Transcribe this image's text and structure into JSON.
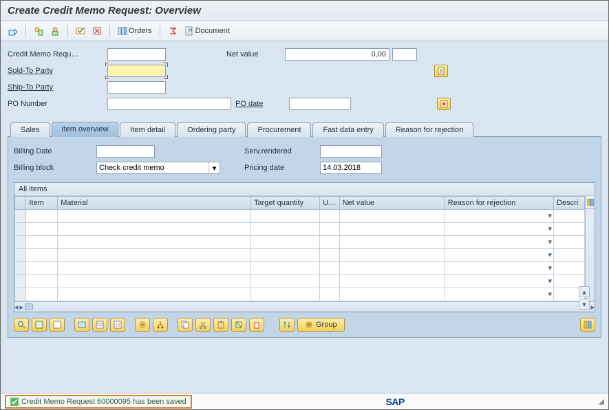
{
  "title": "Create Credit Memo Request: Overview",
  "toolbar": {
    "orders_label": "Orders",
    "document_label": "Document"
  },
  "header": {
    "credit_memo_requ_label": "Credit Memo Requ…",
    "net_value_label": "Net value",
    "net_value": "0,00",
    "sold_to_party_label": "Sold-To Party",
    "ship_to_party_label": "Ship-To Party",
    "po_number_label": "PO Number",
    "po_date_label": "PO date"
  },
  "tabs": {
    "sales": "Sales",
    "item_overview": "Item overview",
    "item_detail": "Item detail",
    "ordering_party": "Ordering party",
    "procurement": "Procurement",
    "fast_data_entry": "Fast data entry",
    "reason_for_rejection": "Reason for rejection"
  },
  "overview": {
    "billing_date_label": "Billing Date",
    "billing_block_label": "Billing block",
    "billing_block_value": "Check credit memo",
    "serv_rendered_label": "Serv.rendered",
    "pricing_date_label": "Pricing date",
    "pricing_date_value": "14.03.2018"
  },
  "grid": {
    "title": "All items",
    "cols": {
      "item": "Item",
      "material": "Material",
      "target_qty": "Target quantity",
      "uom": "U…",
      "net_value": "Net value",
      "reason_rejection": "Reason for rejection",
      "descri": "Descri"
    }
  },
  "bottom": {
    "group_label": "Group"
  },
  "status": {
    "message": "Credit Memo Request 60000095 has been saved"
  }
}
